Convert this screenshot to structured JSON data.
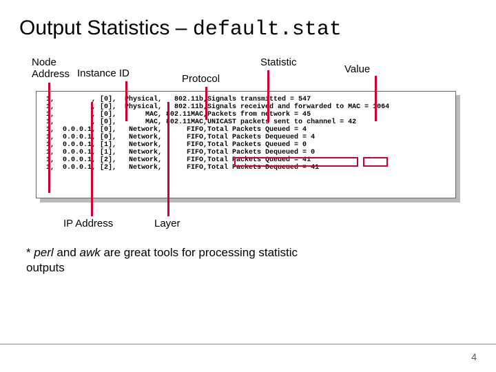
{
  "title_main": "Output Statistics",
  "title_dash": "–",
  "title_code": "default.stat",
  "labels": {
    "node": "Node\nAddress",
    "instance": "Instance ID",
    "protocol": "Protocol",
    "statistic": "Statistic",
    "value": "Value",
    "ip": "IP Address",
    "layer": "Layer"
  },
  "rows": [
    {
      "node": "1",
      "ip": "",
      "inst": "[0]",
      "layer": "Physical",
      "proto": "802.11b",
      "stat": "Signals transmitted",
      "val": "547"
    },
    {
      "node": "1",
      "ip": "",
      "inst": "[0]",
      "layer": "Physical",
      "proto": "802.11b",
      "stat": "Signals received and forwarded to MAC",
      "val": "1064"
    },
    {
      "node": "1",
      "ip": "",
      "inst": "[0]",
      "layer": "MAC",
      "proto": "802.11MAC",
      "stat": "Packets from network",
      "val": "45"
    },
    {
      "node": "1",
      "ip": "",
      "inst": "[0]",
      "layer": "MAC",
      "proto": "802.11MAC",
      "stat": "UNICAST packets sent to channel",
      "val": "42"
    },
    {
      "node": "1",
      "ip": "0.0.0.1",
      "inst": "[0]",
      "layer": "Network",
      "proto": "FIFO",
      "stat": "Total Packets Queued",
      "val": "4"
    },
    {
      "node": "1",
      "ip": "0.0.0.1",
      "inst": "[0]",
      "layer": "Network",
      "proto": "FIFO",
      "stat": "Total Packets Dequeued",
      "val": "4"
    },
    {
      "node": "1",
      "ip": "0.0.0.1",
      "inst": "[1]",
      "layer": "Network",
      "proto": "FIFO",
      "stat": "Total Packets Queued",
      "val": "0"
    },
    {
      "node": "1",
      "ip": "0.0.0.1",
      "inst": "[1]",
      "layer": "Network",
      "proto": "FIFO",
      "stat": "Total Packets Dequeued",
      "val": "0"
    },
    {
      "node": "1",
      "ip": "0.0.0.1",
      "inst": "[2]",
      "layer": "Network",
      "proto": "FIFO",
      "stat": "Total Packets Queued",
      "val": "41"
    },
    {
      "node": "1",
      "ip": "0.0.0.1",
      "inst": "[2]",
      "layer": "Network",
      "proto": "FIFO",
      "stat": "Total Packets Dequeued",
      "val": "41"
    }
  ],
  "footnote_prefix": "* ",
  "footnote_perl": "perl",
  "footnote_mid": " and ",
  "footnote_awk": "awk",
  "footnote_suffix": " are great tools for processing statistic outputs",
  "page_number": "4"
}
